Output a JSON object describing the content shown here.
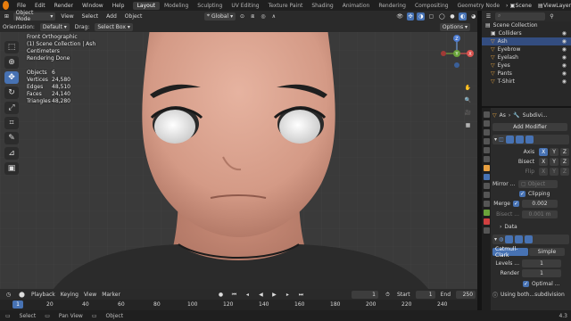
{
  "topbar": {
    "menus": [
      "File",
      "Edit",
      "Render",
      "Window",
      "Help"
    ],
    "workspaces": [
      "Layout",
      "Modeling",
      "Sculpting",
      "UV Editing",
      "Texture Paint",
      "Shading",
      "Animation",
      "Rendering",
      "Compositing",
      "Geometry Node"
    ],
    "active_workspace": "Layout",
    "scene": "Scene",
    "view_layer": "ViewLayer"
  },
  "viewport_header": {
    "mode": "Object Mode",
    "menus": [
      "View",
      "Select",
      "Add",
      "Object"
    ],
    "transform_orientation": "Global",
    "orientation_label": "Orientation:",
    "orientation_value": "Default",
    "drag_label": "Drag:",
    "drag_value": "Select Box",
    "options": "Options"
  },
  "overlay": {
    "view_name": "Front Orthographic",
    "collection": "(1) Scene Collection | Ash",
    "units": "Centimeters",
    "status": "Rendering Done",
    "stats": [
      {
        "label": "Objects",
        "value": "6"
      },
      {
        "label": "Vertices",
        "value": "24,580"
      },
      {
        "label": "Edges",
        "value": "48,510"
      },
      {
        "label": "Faces",
        "value": "24,140"
      },
      {
        "label": "Triangles",
        "value": "48,280"
      }
    ]
  },
  "gizmo": {
    "x": "X",
    "y": "Y",
    "z": "Z"
  },
  "outliner": {
    "root": "Scene Collection",
    "items": [
      {
        "name": "Colliders",
        "icon": "collection-icon"
      },
      {
        "name": "Ash",
        "icon": "mesh-icon"
      },
      {
        "name": "Eyebrow",
        "icon": "mesh-icon"
      },
      {
        "name": "Eyelash",
        "icon": "mesh-icon"
      },
      {
        "name": "Eyes",
        "icon": "mesh-icon"
      },
      {
        "name": "Pants",
        "icon": "mesh-icon"
      },
      {
        "name": "T-Shirt",
        "icon": "mesh-icon"
      }
    ]
  },
  "properties": {
    "object": "As",
    "modifier_tab": "Subdivi...",
    "add_modifier": "Add Modifier",
    "mirror": {
      "axis_label": "Axis",
      "bisect_label": "Bisect",
      "flip_label": "Flip",
      "mirror_obj_label": "Mirror ...",
      "mirror_obj_placeholder": "Object",
      "clipping": "Clipping",
      "merge_label": "Merge",
      "merge_value": "0.002",
      "bisect_dist_label": "Bisect ...",
      "bisect_dist_value": "0.001 m",
      "axes": [
        "X",
        "Y",
        "Z"
      ]
    },
    "data_label": "Data",
    "subdivision": {
      "catmull": "Catmull-Clark",
      "simple": "Simple",
      "levels_label": "Levels ...",
      "levels_value": "1",
      "render_label": "Render",
      "render_value": "1",
      "optimal": "Optimal ...",
      "warning": "Using both...subdivision"
    }
  },
  "timeline": {
    "menus": [
      "Playback",
      "Keying",
      "View",
      "Marker"
    ],
    "current_frame": "1",
    "start_label": "Start",
    "start": "1",
    "end_label": "End",
    "end": "250",
    "ticks": [
      "1",
      "20",
      "40",
      "60",
      "80",
      "100",
      "120",
      "140",
      "160",
      "180",
      "200",
      "220",
      "240"
    ]
  },
  "statusbar": {
    "select": "Select",
    "pan": "Pan View",
    "object": "Object",
    "version": "4.3"
  },
  "colors": {
    "accent": "#4772b3",
    "skin": "#d9a592",
    "shirt": "#2b2b2b",
    "bg": "#3a3a3a"
  }
}
